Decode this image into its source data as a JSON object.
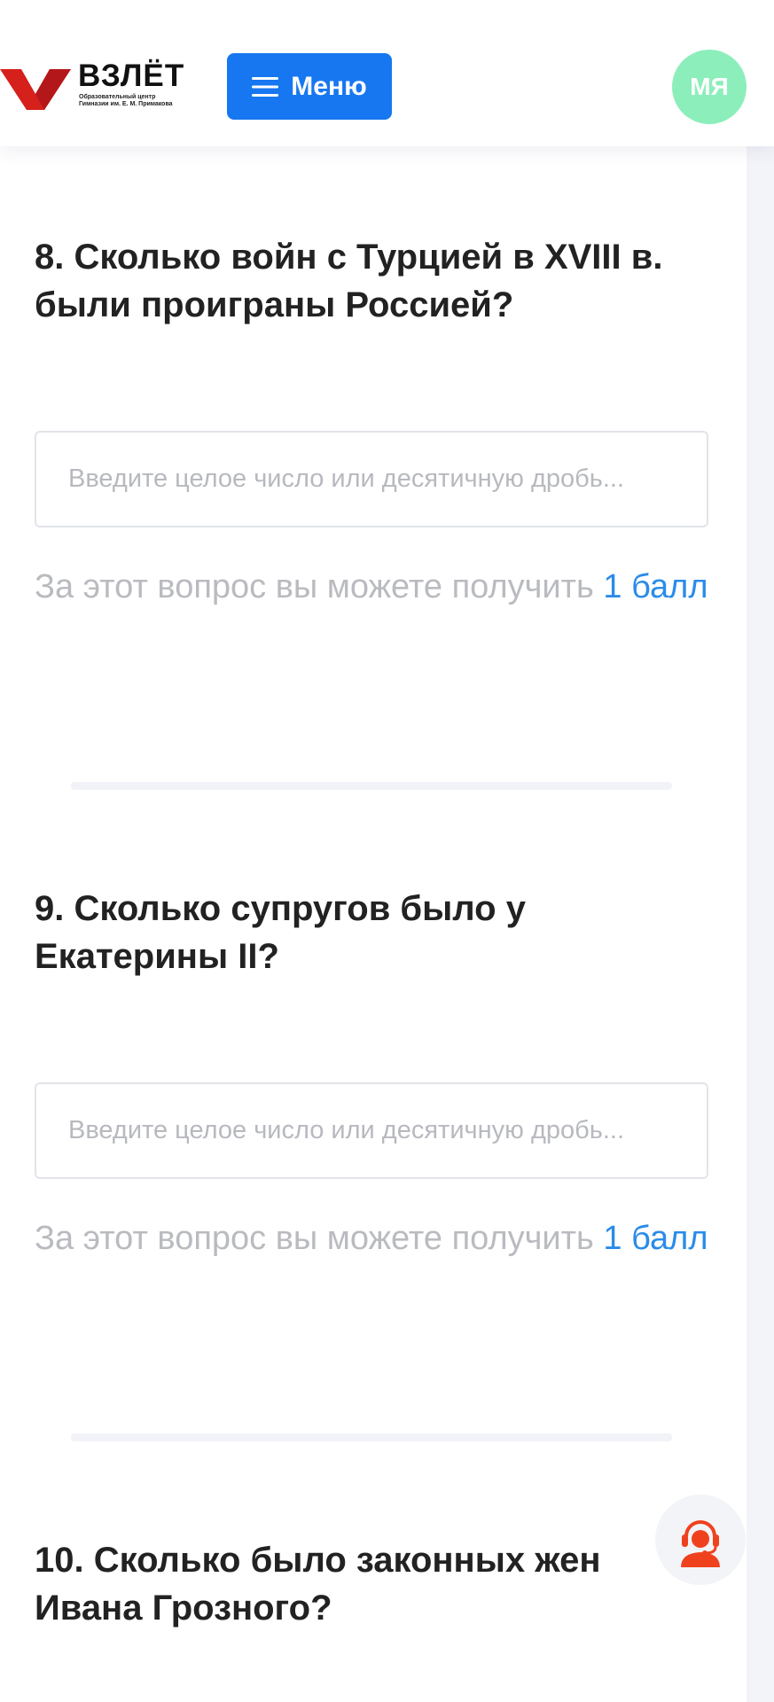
{
  "header": {
    "logo_title": "ВЗЛЁТ",
    "logo_subtitle_line1": "Образовательный центр",
    "logo_subtitle_line2": "Гимназии им. Е. М. Примакова",
    "menu_label": "Меню",
    "menu_icon": "hamburger-icon",
    "avatar_initials": "МЯ",
    "avatar_color": "#8ceebb",
    "accent_color": "#1777f1"
  },
  "questions": [
    {
      "title": "8. Сколько войн с Турцией в XVIII в. были проиграны Россией?",
      "placeholder": "Введите целое число или десятичную дробь...",
      "points_text": "За этот вопрос вы можете получить",
      "points_value": "1 балл"
    },
    {
      "title": "9. Сколько супругов было у Екатерины II?",
      "placeholder": "Введите целое число или десятичную дробь...",
      "points_text": "За этот вопрос вы можете получить",
      "points_value": "1 балл"
    },
    {
      "title": "10. Сколько было законных жен Ивана Грозного?"
    }
  ],
  "support": {
    "icon": "support-operator-icon",
    "color": "#f0411f"
  }
}
